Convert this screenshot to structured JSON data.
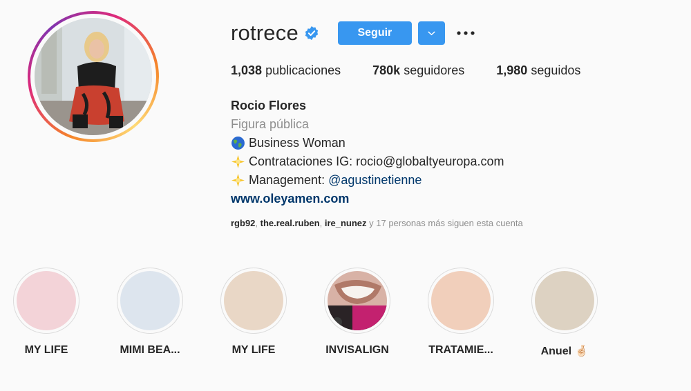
{
  "profile": {
    "username": "rotrece",
    "verified_icon": "verified-badge-icon",
    "follow_label": "Seguir",
    "more_label": "•••"
  },
  "stats": {
    "posts_count": "1,038",
    "posts_label": "publicaciones",
    "followers_count": "780k",
    "followers_label": "seguidores",
    "following_count": "1,980",
    "following_label": "seguidos"
  },
  "bio": {
    "name": "Rocio Flores",
    "category": "Figura pública",
    "line1": "Business Woman",
    "line2": "Contrataciones IG: rocio@globaltyeuropa.com",
    "line3_prefix": "Management: ",
    "line3_mention": "@agustinetienne",
    "website": "www.oleyamen.com"
  },
  "followed_by": {
    "user1": "rgb92",
    "user2": "the.real.ruben",
    "user3": "ire_nunez",
    "rest": " y 17 personas más siguen esta cuenta"
  },
  "highlights": [
    {
      "label": "MY LIFE",
      "color": "#f3d3d8"
    },
    {
      "label": "MIMI BEA...",
      "color": "#dde5ee"
    },
    {
      "label": "MY LIFE",
      "color": "#e9d7c6"
    },
    {
      "label": "INVISALIGN",
      "color": "#c9a49a"
    },
    {
      "label": "TRATAMIE...",
      "color": "#f1cfbb"
    },
    {
      "label": "Anuel 🤞🏻",
      "color": "#ddd2c2"
    }
  ],
  "colors": {
    "accent": "#3897f0",
    "link": "#00376b",
    "muted": "#8e8e8e"
  }
}
